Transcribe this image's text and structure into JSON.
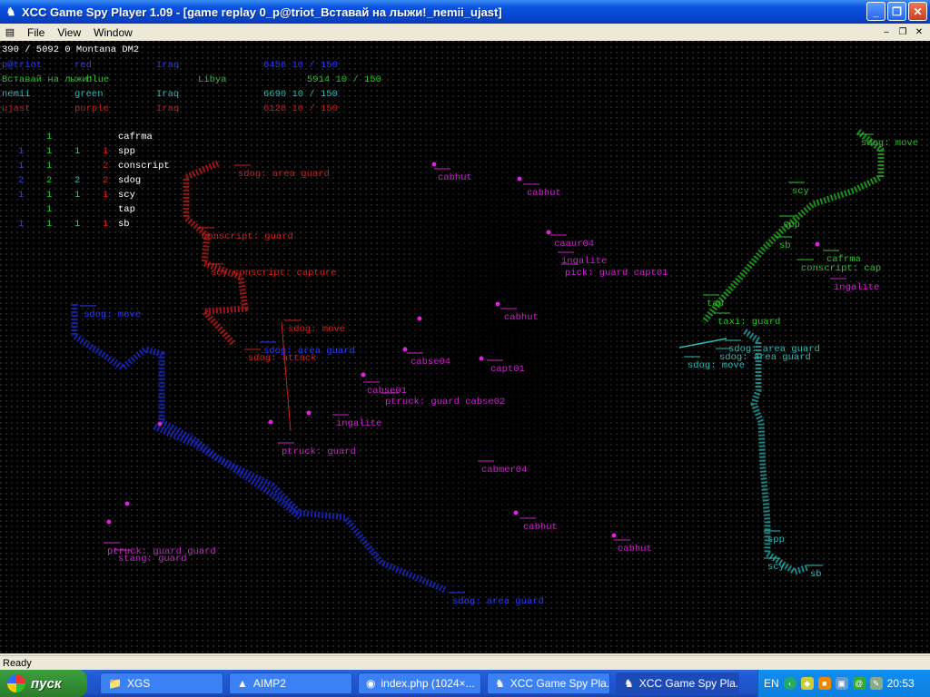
{
  "window": {
    "title": "XCC Game Spy Player 1.09 - [game replay 0_p@triot_Вставай на лыжи!_nemii_ujast]",
    "app_icon": "xcc-app-icon"
  },
  "menu": {
    "items": [
      "File",
      "View",
      "Window"
    ]
  },
  "status": {
    "text": "Ready"
  },
  "header_line": "390 / 5092 0 Montana DM2",
  "players": [
    {
      "name": "p@triot",
      "color_name": "red",
      "country": "Iraq",
      "money": "6456 10 / 150",
      "color": "#1a2bd6"
    },
    {
      "name": "Вставай на лыжи!",
      "color_name": "blue",
      "country": "Libya",
      "money": "5914 10 / 150",
      "color": "#2ac22a"
    },
    {
      "name": "nemii",
      "color_name": "green",
      "country": "Iraq",
      "money": "6690 10 / 150",
      "color": "#2fb8b8"
    },
    {
      "name": "ujast",
      "color_name": "purple",
      "country": "Iraq",
      "money": "6128 10 / 150",
      "color": "#c42020"
    }
  ],
  "unit_table": [
    {
      "cols": [
        "",
        "1",
        "",
        ""
      ],
      "unit": "cafrma"
    },
    {
      "cols": [
        "1",
        "1",
        "1",
        "1"
      ],
      "unit": "spp"
    },
    {
      "cols": [
        "1",
        "1",
        "",
        "2"
      ],
      "unit": "conscript"
    },
    {
      "cols": [
        "2",
        "2",
        "2",
        "2"
      ],
      "unit": "sdog"
    },
    {
      "cols": [
        "1",
        "1",
        "1",
        "1"
      ],
      "unit": "scy"
    },
    {
      "cols": [
        "",
        "1",
        "",
        ""
      ],
      "unit": "tap"
    },
    {
      "cols": [
        "1",
        "1",
        "1",
        "1"
      ],
      "unit": "sb"
    }
  ],
  "unit_table_col_colors": [
    "#2a3cff",
    "#2ac22a",
    "#2fb8b8",
    "#d02020"
  ],
  "map_labels": [
    {
      "text": "sdog: area guard",
      "color": "#d02020"
    },
    {
      "text": "conscript: guard",
      "color": "#d02020"
    },
    {
      "text": "scy conscript: capture",
      "color": "#d02020"
    },
    {
      "text": "sdog: move",
      "color": "#d02020"
    },
    {
      "text": "sdog: attack",
      "color": "#d02020"
    },
    {
      "text": "sdog: move",
      "color": "#2a3cff"
    },
    {
      "text": "sdog: area guard",
      "color": "#2a3cff"
    },
    {
      "text": "cabhut",
      "color": "#d020d0"
    },
    {
      "text": "cabhut",
      "color": "#d020d0"
    },
    {
      "text": "caaur04",
      "color": "#d020d0"
    },
    {
      "text": "ingalite",
      "color": "#d020d0"
    },
    {
      "text": "pick: guard capt01",
      "color": "#d020d0"
    },
    {
      "text": "cabhut",
      "color": "#d020d0"
    },
    {
      "text": "cabse04",
      "color": "#d020d0"
    },
    {
      "text": "capt01",
      "color": "#d020d0"
    },
    {
      "text": "cabse01",
      "color": "#d020d0"
    },
    {
      "text": "ptruck: guard cabse02",
      "color": "#d020d0"
    },
    {
      "text": "ingalite",
      "color": "#d020d0"
    },
    {
      "text": "ptruck: guard",
      "color": "#d020d0"
    },
    {
      "text": "cabmer04",
      "color": "#d020d0"
    },
    {
      "text": "cabhut",
      "color": "#d020d0"
    },
    {
      "text": "cabhut",
      "color": "#d020d0"
    },
    {
      "text": "ptruck: guard guard",
      "color": "#d020d0"
    },
    {
      "text": "stang: guard",
      "color": "#d020d0"
    },
    {
      "text": "sdog: area guard",
      "color": "#2a3cff"
    },
    {
      "text": "sdog: move",
      "color": "#2ac22a"
    },
    {
      "text": "scy",
      "color": "#2ac22a"
    },
    {
      "text": "spp",
      "color": "#2ac22a"
    },
    {
      "text": "sb",
      "color": "#2ac22a"
    },
    {
      "text": "cafrma",
      "color": "#2ac22a"
    },
    {
      "text": "conscript: cap",
      "color": "#2ac22a"
    },
    {
      "text": "ingalite",
      "color": "#d020d0"
    },
    {
      "text": "tap",
      "color": "#2ac22a"
    },
    {
      "text": "taxi: guard",
      "color": "#2ac22a"
    },
    {
      "text": "sdog: area guard",
      "color": "#2fb8b8"
    },
    {
      "text": "sdog: area guard",
      "color": "#2fb8b8"
    },
    {
      "text": "sdog: move",
      "color": "#2fb8b8"
    },
    {
      "text": "spp",
      "color": "#2fb8b8"
    },
    {
      "text": "scy",
      "color": "#2fb8b8"
    },
    {
      "text": "sb",
      "color": "#2fb8b8"
    }
  ],
  "taskbar": {
    "start_label": "пуск",
    "tasks": [
      {
        "label": "XGS",
        "icon": "folder-icon"
      },
      {
        "label": "AIMP2",
        "icon": "aimp-icon"
      },
      {
        "label": "index.php (1024×...",
        "icon": "browser-icon"
      },
      {
        "label": "XCC Game Spy Pla...",
        "icon": "xcc-app-icon"
      },
      {
        "label": "XCC Game Spy Pla...",
        "icon": "xcc-app-icon"
      }
    ],
    "lang": "EN",
    "clock": "20:53"
  }
}
